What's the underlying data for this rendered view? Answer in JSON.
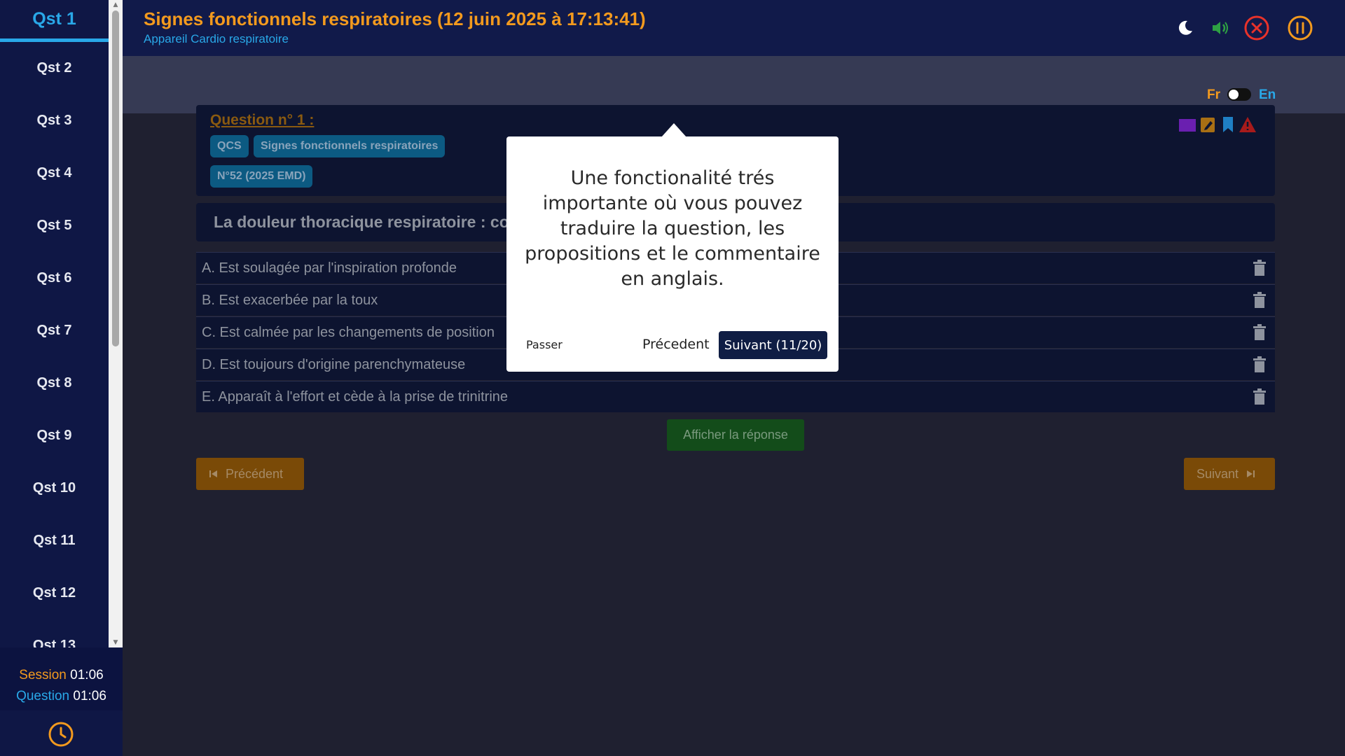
{
  "sidebar": {
    "items": [
      {
        "label": "Qst 1"
      },
      {
        "label": "Qst 2"
      },
      {
        "label": "Qst 3"
      },
      {
        "label": "Qst 4"
      },
      {
        "label": "Qst 5"
      },
      {
        "label": "Qst 6"
      },
      {
        "label": "Qst 7"
      },
      {
        "label": "Qst 8"
      },
      {
        "label": "Qst 9"
      },
      {
        "label": "Qst 10"
      },
      {
        "label": "Qst 11"
      },
      {
        "label": "Qst 12"
      },
      {
        "label": "Qst 13"
      }
    ],
    "active_index": 0
  },
  "timers": {
    "session_label": "Session",
    "session_value": "01:06",
    "question_label": "Question",
    "question_value": "01:06"
  },
  "header": {
    "title": "Signes fonctionnels respiratoires (12 juin 2025 à 17:13:41)",
    "subtitle": "Appareil Cardio respiratoire",
    "icons": [
      "moon-icon",
      "volume-icon",
      "close-circle-icon",
      "pause-circle-icon"
    ]
  },
  "language": {
    "fr": "Fr",
    "en": "En",
    "selected": "Fr"
  },
  "question": {
    "number_label": "Question n° 1 :",
    "tags": [
      "QCS",
      "Signes fonctionnels respiratoires",
      "N°52 (2025 EMD)"
    ],
    "text": "La douleur thoracique respiratoire : co",
    "card_icons": [
      "color-square-icon",
      "edit-note-icon",
      "bookmark-icon",
      "warning-icon"
    ]
  },
  "options": [
    {
      "text": "A. Est soulagée par l'inspiration profonde"
    },
    {
      "text": "B. Est exacerbée par la toux"
    },
    {
      "text": "C. Est calmée par les changements de position"
    },
    {
      "text": "D. Est toujours d'origine parenchymateuse"
    },
    {
      "text": "E. Apparaît à l'effort et cède à la prise de trinitrine"
    }
  ],
  "actions": {
    "reveal": "Afficher la réponse",
    "previous": "Précédent",
    "next": "Suivant"
  },
  "tour": {
    "text": "Une fonctionalité trés importante où vous pouvez traduire la question, les propositions et le commentaire en anglais.",
    "skip": "Passer",
    "previous": "Précedent",
    "next": "Suivant (11/20)"
  },
  "colors": {
    "accent_orange": "#f39a1e",
    "accent_blue": "#29a8e8",
    "sidebar_bg": "#0f1745",
    "danger": "#e8322a",
    "success": "#2ea043"
  }
}
